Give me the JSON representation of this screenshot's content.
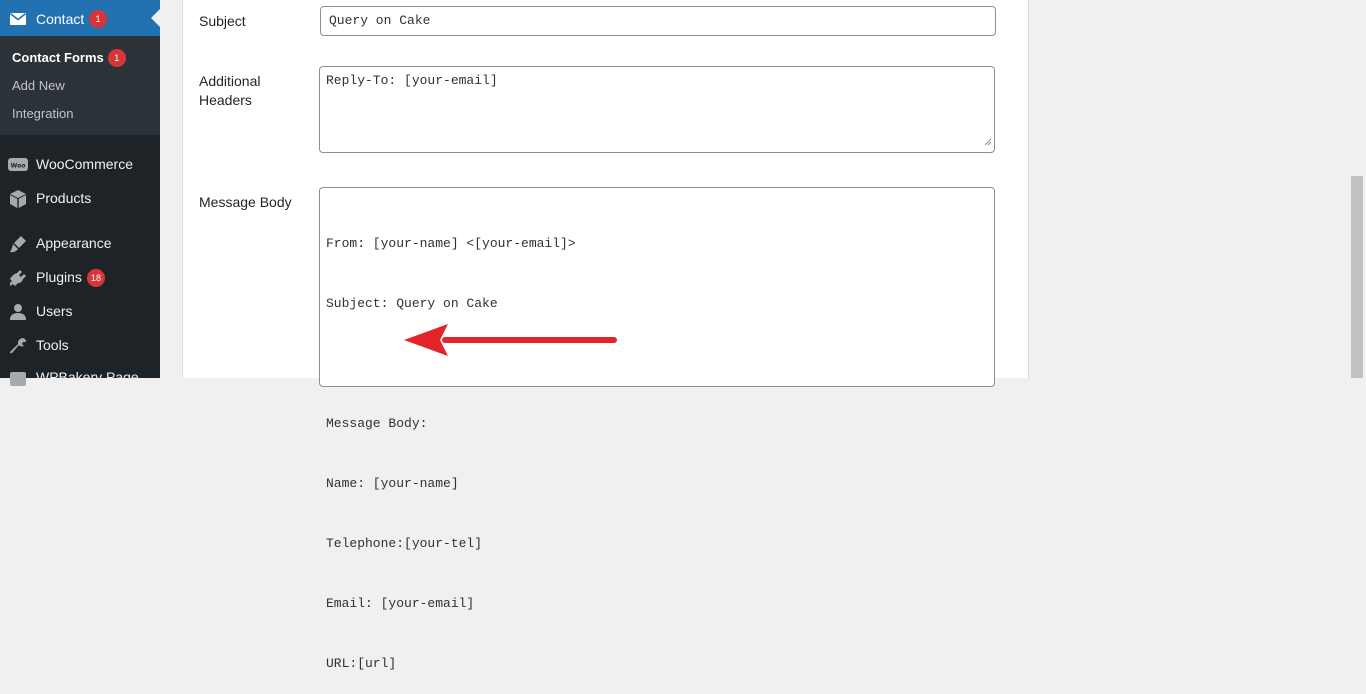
{
  "sidebar": {
    "contact": {
      "label": "Contact",
      "badge": "1"
    },
    "submenu": [
      {
        "label": "Contact Forms",
        "badge": "1",
        "current": true
      },
      {
        "label": "Add New"
      },
      {
        "label": "Integration"
      }
    ],
    "items": [
      {
        "label": "WooCommerce",
        "icon": "woocommerce-icon"
      },
      {
        "label": "Products",
        "icon": "box-icon"
      },
      {
        "label": "Appearance",
        "icon": "brush-icon"
      },
      {
        "label": "Plugins",
        "icon": "plug-icon",
        "badge": "18"
      },
      {
        "label": "Users",
        "icon": "user-icon"
      },
      {
        "label": "Tools",
        "icon": "wrench-icon"
      },
      {
        "label": "WPBakery Page",
        "icon": "wpbakery-icon"
      }
    ]
  },
  "form": {
    "subject": {
      "label": "Subject",
      "value": "Query on Cake"
    },
    "additional_headers": {
      "label": "Additional\nHeaders",
      "value": "Reply-To: [your-email]"
    },
    "message_body": {
      "label": "Message Body",
      "lines": [
        "From: [your-name] <[your-email]>",
        "Subject: Query on Cake",
        "",
        "Message Body:",
        "Name: [your-name]",
        "Telephone:[your-tel]",
        "Email: [your-email]",
        "URL:[url]"
      ]
    }
  },
  "colors": {
    "sidebar_bg": "#1d2327",
    "active_menu": "#2271b1",
    "badge": "#d63638",
    "annotation_arrow": "#e3242b"
  }
}
